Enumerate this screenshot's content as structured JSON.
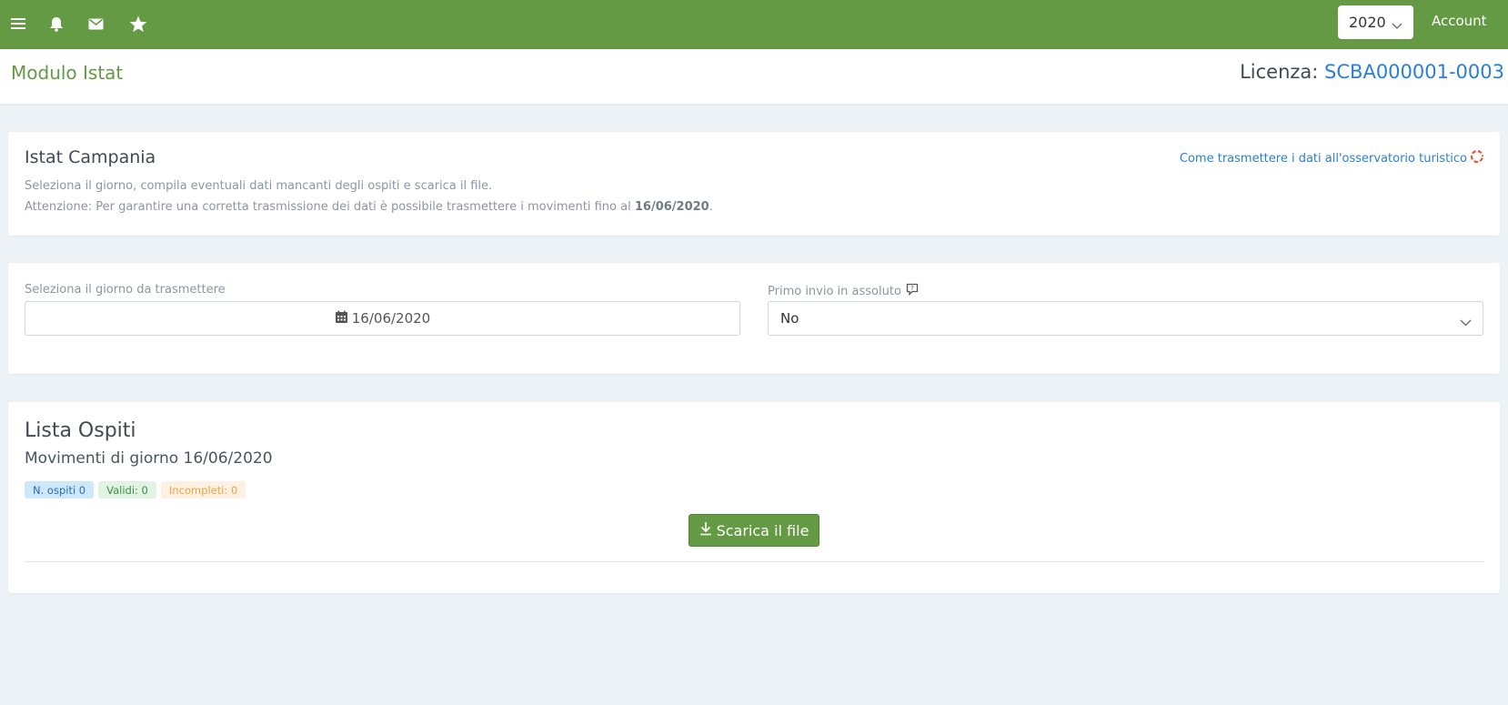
{
  "topbar": {
    "icons": [
      "menu-icon",
      "bell-icon",
      "mail-icon",
      "star-icon"
    ],
    "year": "2020",
    "account_label": "Account",
    "color": "#649a44"
  },
  "header": {
    "title": "Modulo Istat",
    "license_label": "Licenza:",
    "license_code": "SCBA000001-0003"
  },
  "info_card": {
    "title": "Istat Campania",
    "help_link": "Come trasmettere i dati all'osservatorio turistico",
    "line1": "Seleziona il giorno, compila eventuali dati mancanti degli ospiti e scarica il file.",
    "line2_prefix": "Attenzione: Per garantire una corretta trasmissione dei dati è possibile trasmettere i movimenti fino al",
    "line2_date": "16/06/2020",
    "line2_suffix": "."
  },
  "form": {
    "date_label": "Seleziona il giorno da trasmettere",
    "date_value": "16/06/2020",
    "first_send_label": "Primo invio in assoluto",
    "first_send_value": "No"
  },
  "guests": {
    "title": "Lista Ospiti",
    "subtitle": "Movimenti di giorno 16/06/2020",
    "badge_total": "N. ospiti 0",
    "badge_valid": "Validi: 0",
    "badge_incomplete": "Incompleti: 0",
    "download_label": "Scarica il file"
  }
}
